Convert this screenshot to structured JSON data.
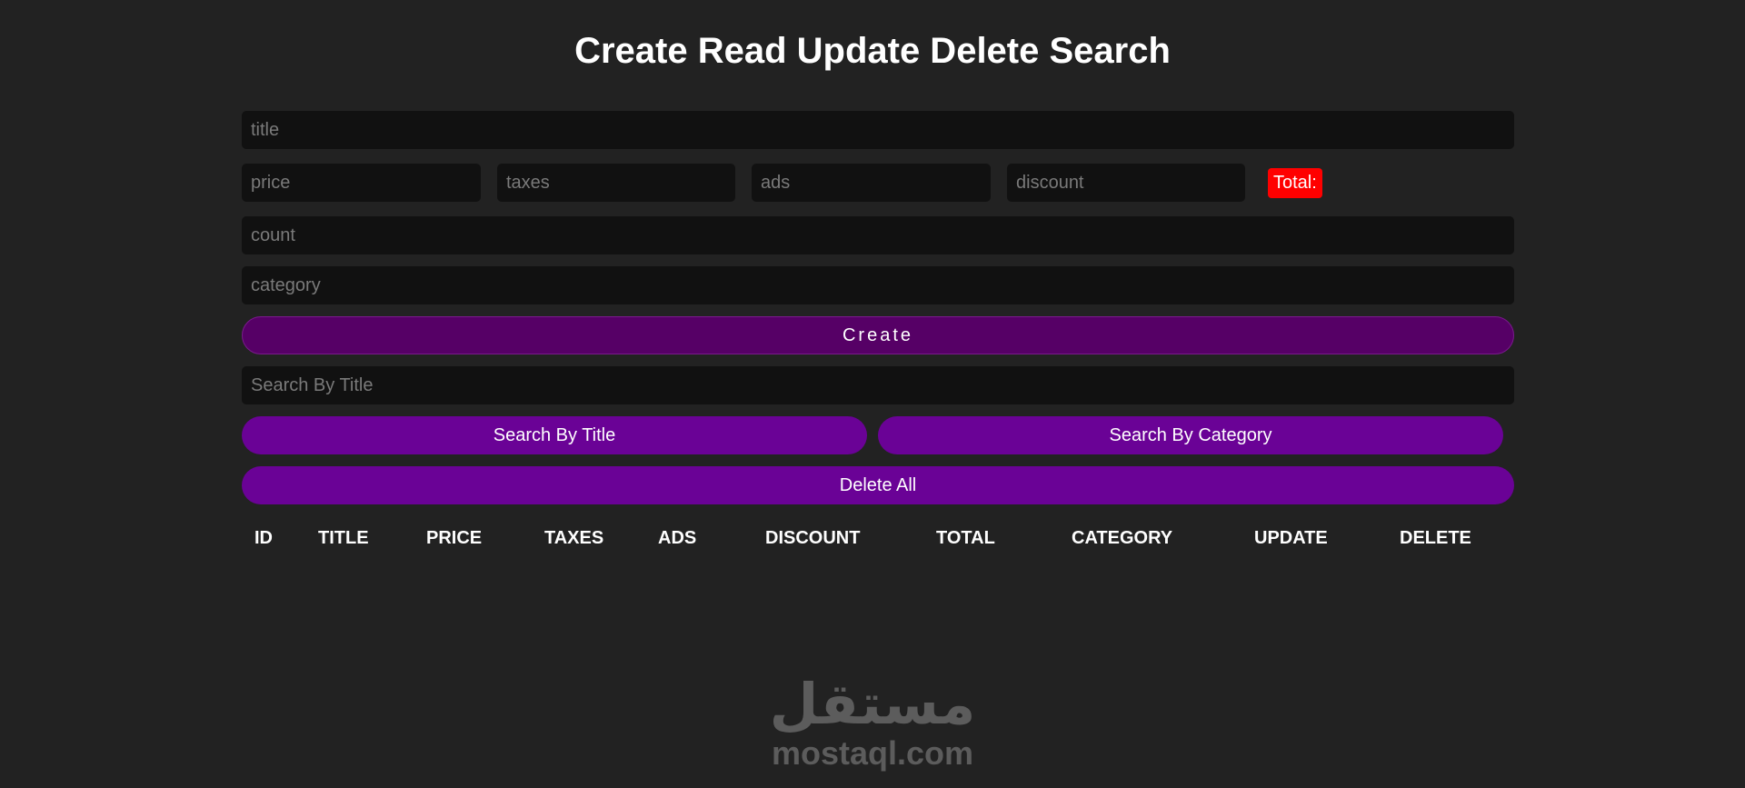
{
  "header": {
    "title": "Create Read Update Delete Search"
  },
  "form": {
    "title_placeholder": "title",
    "price_placeholder": "price",
    "taxes_placeholder": "taxes",
    "ads_placeholder": "ads",
    "discount_placeholder": "discount",
    "total_label": "Total:",
    "count_placeholder": "count",
    "category_placeholder": "category",
    "create_label": "Create"
  },
  "search": {
    "placeholder": "Search By Title",
    "by_title_label": "Search By Title",
    "by_category_label": "Search By Category",
    "delete_all_label": "Delete All"
  },
  "table": {
    "columns": [
      "ID",
      "TITLE",
      "PRICE",
      "TAXES",
      "ADS",
      "DISCOUNT",
      "TOTAL",
      "CATEGORY",
      "UPDATE",
      "DELETE"
    ]
  },
  "watermark": {
    "arabic": "مستقل",
    "latin": "mostaql.com"
  },
  "colors": {
    "background": "#222222",
    "input": "#111111",
    "create": "#560066",
    "button": "#6a0296",
    "total": "#ff0000"
  }
}
